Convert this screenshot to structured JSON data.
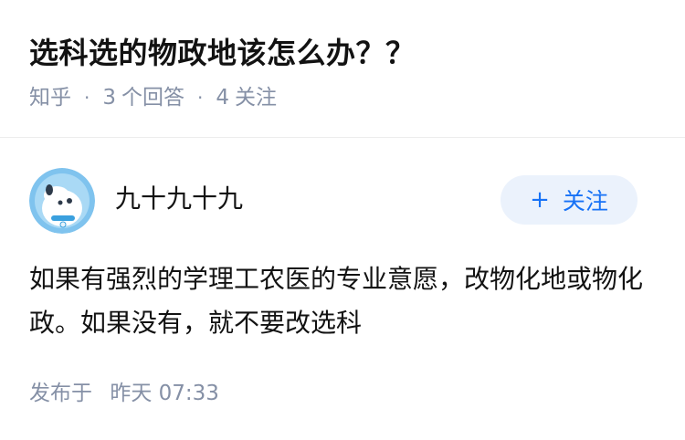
{
  "question": {
    "title": "选科选的物政地该怎么办？？",
    "source": "知乎",
    "answers_count": "3",
    "answers_label": "个回答",
    "followers_count": "4",
    "followers_label": "关注"
  },
  "answer": {
    "author_name": "九十九十九",
    "follow_label": "关注",
    "follow_icon": "plus-icon",
    "text": "如果有强烈的学理工农医的专业意愿，改物化地或物化政。如果没有，就不要改选科",
    "publish_label": "发布于",
    "publish_day": "昨天",
    "publish_time": "07:33"
  },
  "colors": {
    "accent": "#1772f6",
    "follow_bg": "#ebf2fc",
    "meta_text": "#8590a6"
  }
}
